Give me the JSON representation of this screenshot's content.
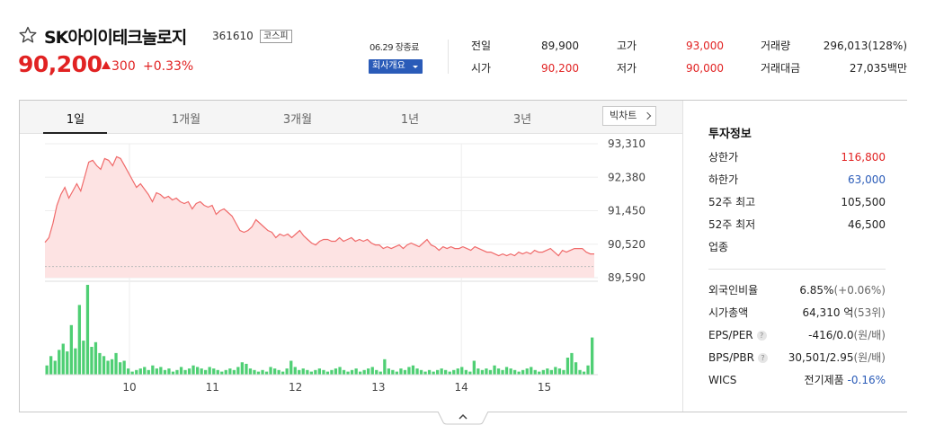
{
  "header": {
    "name": "SK아이이테크놀로지",
    "code": "361610",
    "market": "코스피",
    "price": "90,200",
    "change_amount": "300",
    "change_percent": "+0.33%",
    "closing_date": "06.29 장종료",
    "company_button": "회사개요"
  },
  "summary": {
    "prev_close_label": "전일",
    "prev_close": "89,900",
    "open_label": "시가",
    "open": "90,200",
    "high_label": "고가",
    "high": "93,000",
    "low_label": "저가",
    "low": "90,000",
    "volume_label": "거래량",
    "volume": "296,013(128%)",
    "amount_label": "거래대금",
    "amount": "27,035백만"
  },
  "tabs": [
    "1일",
    "1개월",
    "3개월",
    "1년",
    "3년"
  ],
  "active_tab": "1일",
  "big_chart_button": "빅차트",
  "invest": {
    "title": "투자정보",
    "rows": [
      {
        "label": "상한가",
        "value": "116,800",
        "tone": "red"
      },
      {
        "label": "하한가",
        "value": "63,000",
        "tone": "blue"
      },
      {
        "label": "52주 최고",
        "value": "105,500",
        "tone": "normal"
      },
      {
        "label": "52주 최저",
        "value": "46,500",
        "tone": "normal"
      },
      {
        "label": "업종",
        "value": "",
        "tone": "normal"
      }
    ],
    "rows2": [
      {
        "label": "외국인비율",
        "value": "6.85%",
        "extra": "(+0.06%)",
        "help": false
      },
      {
        "label": "시가총액",
        "value": "64,310 억",
        "extra": "(53위)",
        "help": false
      },
      {
        "label": "EPS/PER",
        "value": "-416/0.0",
        "extra": "(원/배)",
        "help": true
      },
      {
        "label": "BPS/PBR",
        "value": "30,501/2.95",
        "extra": "(원/배)",
        "help": true
      },
      {
        "label": "WICS",
        "value": "전기제품",
        "extra": "-0.16%",
        "help": false
      }
    ]
  },
  "colors": {
    "up_red": "#e12222",
    "down_blue": "#2a5bb8",
    "line": "#f06a6a",
    "area": "#fde3e3",
    "volume_bar": "#4fcf74"
  },
  "chart_data": {
    "type": "line",
    "title": "",
    "x_tick_labels": [
      "10",
      "11",
      "12",
      "13",
      "14",
      "15"
    ],
    "y_tick_labels": [
      "93,310",
      "92,380",
      "91,450",
      "90,520",
      "89,590"
    ],
    "ylim": [
      89590,
      93310
    ],
    "prev_close": 89900,
    "series": [
      {
        "values": [
          90570,
          90700,
          91100,
          91600,
          91900,
          92100,
          91800,
          92000,
          92200,
          92000,
          92400,
          92800,
          92850,
          92700,
          92600,
          92900,
          92850,
          92700,
          92950,
          92900,
          92700,
          92500,
          92300,
          92100,
          92200,
          92050,
          91900,
          91700,
          91950,
          91900,
          91800,
          91850,
          91750,
          91800,
          91700,
          91650,
          91700,
          91500,
          91650,
          91700,
          91600,
          91550,
          91600,
          91350,
          91450,
          91500,
          91400,
          91300,
          91100,
          90900,
          90850,
          90900,
          91000,
          91200,
          91100,
          91000,
          90900,
          90850,
          90700,
          90800,
          90750,
          90800,
          90700,
          90800,
          90900,
          90750,
          90650,
          90550,
          90500,
          90600,
          90650,
          90650,
          90600,
          90600,
          90700,
          90600,
          90650,
          90700,
          90600,
          90650,
          90600,
          90650,
          90550,
          90500,
          90500,
          90400,
          90450,
          90400,
          90450,
          90500,
          90400,
          90500,
          90550,
          90500,
          90450,
          90550,
          90650,
          90500,
          90450,
          90350,
          90450,
          90400,
          90450,
          90400,
          90400,
          90450,
          90400,
          90350,
          90450,
          90400,
          90350,
          90300,
          90300,
          90250,
          90200,
          90250,
          90200,
          90250,
          90200,
          90300,
          90250,
          90300,
          90250,
          90350,
          90300,
          90300,
          90350,
          90400,
          90300,
          90200,
          90350,
          90300,
          90350,
          90400,
          90400,
          90400,
          90300,
          90250,
          90250
        ]
      }
    ],
    "volume": [
      6,
      12,
      9,
      16,
      20,
      15,
      32,
      17,
      45,
      22,
      58,
      18,
      21,
      14,
      12,
      9,
      10,
      14,
      8,
      9,
      4,
      2,
      3,
      4,
      5,
      3,
      6,
      4,
      5,
      3,
      4,
      2,
      3,
      5,
      3,
      4,
      6,
      5,
      4,
      3,
      5,
      4,
      3,
      2,
      3,
      4,
      3,
      5,
      8,
      7,
      4,
      3,
      2,
      3,
      2,
      5,
      4,
      3,
      2,
      4,
      9,
      5,
      3,
      4,
      3,
      2,
      3,
      4,
      3,
      2,
      3,
      4,
      5,
      3,
      2,
      3,
      4,
      2,
      3,
      4,
      5,
      3,
      2,
      10,
      4,
      3,
      2,
      4,
      3,
      5,
      6,
      4,
      3,
      2,
      3,
      2,
      3,
      4,
      3,
      2,
      3,
      4,
      5,
      3,
      2,
      9,
      4,
      3,
      4,
      3,
      6,
      4,
      3,
      5,
      4,
      3,
      2,
      3,
      4,
      5,
      3,
      2,
      3,
      4,
      3,
      5,
      4,
      3,
      11,
      14,
      8,
      3,
      2,
      6,
      24
    ]
  }
}
